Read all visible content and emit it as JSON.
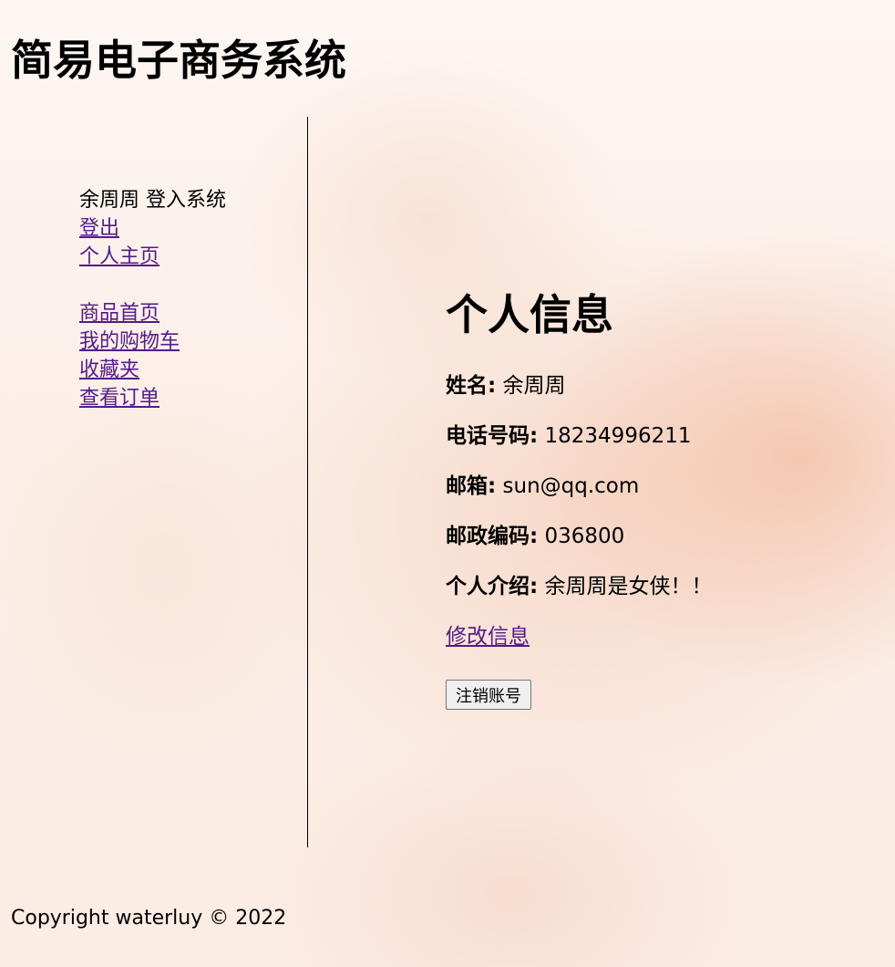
{
  "header": {
    "title": "简易电子商务系统"
  },
  "sidebar": {
    "login_status": "余周周 登入系统",
    "logout": "登出",
    "profile": "个人主页",
    "links": [
      "商品首页",
      "我的购物车",
      "收藏夹",
      "查看订单"
    ]
  },
  "main": {
    "heading": "个人信息",
    "fields": [
      {
        "label": "姓名:",
        "value": "余周周"
      },
      {
        "label": "电话号码:",
        "value": "18234996211"
      },
      {
        "label": "邮箱:",
        "value": "sun@qq.com"
      },
      {
        "label": "邮政编码:",
        "value": "036800"
      },
      {
        "label": "个人介绍:",
        "value": "余周周是女侠！！"
      }
    ],
    "edit_link": "修改信息",
    "cancel_button": "注销账号"
  },
  "footer": {
    "copyright": "Copyright waterluy © 2022"
  },
  "colors": {
    "link": "#551a8b",
    "text": "#000000",
    "background_accent": "#f0af91"
  }
}
